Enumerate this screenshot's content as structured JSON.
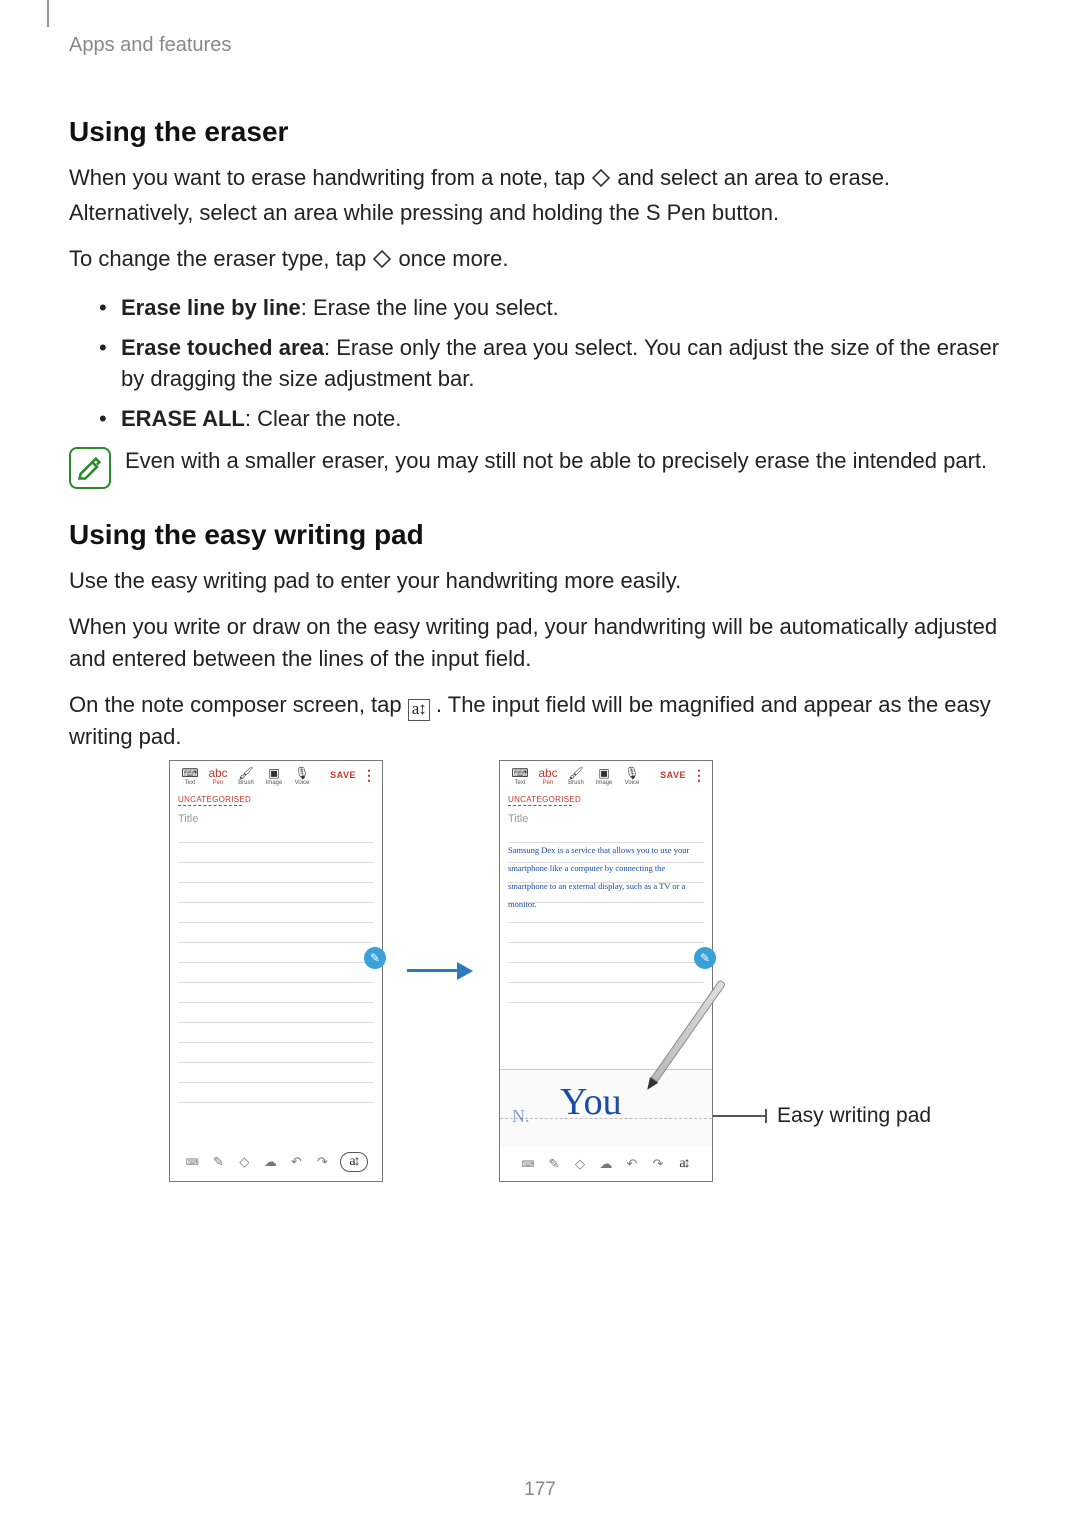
{
  "breadcrumb": "Apps and features",
  "h1": "Using the eraser",
  "p1a": "When you want to erase handwriting from a note, tap ",
  "p1b": " and select an area to erase. Alternatively, select an area while pressing and holding the S Pen button.",
  "p2a": "To change the eraser type, tap ",
  "p2b": " once more.",
  "b1_strong": "Erase line by line",
  "b1_rest": ": Erase the line you select.",
  "b2_strong": "Erase touched area",
  "b2_rest": ": Erase only the area you select. You can adjust the size of the eraser by dragging the size adjustment bar.",
  "b3_strong": "ERASE ALL",
  "b3_rest": ": Clear the note.",
  "note": "Even with a smaller eraser, you may still not be able to precisely erase the intended part.",
  "h2": "Using the easy writing pad",
  "p3": "Use the easy writing pad to enter your handwriting more easily.",
  "p4": "When you write or draw on the easy writing pad, your handwriting will be automatically adjusted and entered between the lines of the input field.",
  "p5a": "On the note composer screen, tap ",
  "p5b": ". The input field will be magnified and appear as the easy writing pad.",
  "phone": {
    "tools": {
      "text": "Text",
      "pen": "Pen",
      "brush": "Brush",
      "image": "Image",
      "voice": "Voice"
    },
    "pen_glyph": "abc",
    "save": "SAVE",
    "more": "⋮",
    "category": "UNCATEGORISED",
    "title": "Title",
    "handwriting": "Samsung Dex is a service that allows you to use your smartphone like a computer by connecting the smartphone to an external display, such as a TV or a monitor.",
    "you": "You",
    "stroke": "N."
  },
  "callout": "Easy writing pad",
  "a_icon": "a↕",
  "pagenum": "177"
}
